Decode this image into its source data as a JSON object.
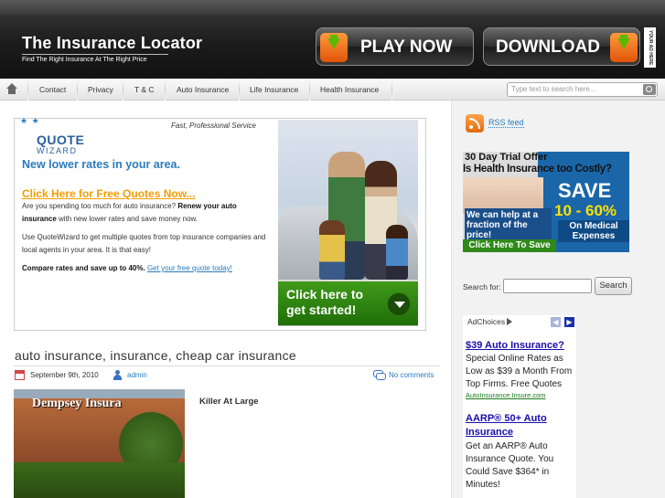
{
  "header": {
    "title": "The Insurance Locator",
    "tagline": "Find The Right Insurance At The Right Price",
    "play_label": "PLAY NOW",
    "download_label": "DOWNLOAD",
    "side_tab": "YOUR AD HERE"
  },
  "nav": {
    "items": [
      "Contact",
      "Privacy",
      "T & C",
      "Auto Insurance",
      "Life Insurance",
      "Health Insurance"
    ],
    "search_placeholder": "Type text to search here..."
  },
  "ad": {
    "logo_stars": "★ ★",
    "logo_line1": "QUOTE",
    "logo_line2": "WIZARD",
    "fast_service": "Fast, Professional Service",
    "headline": "New lower rates in your area.",
    "cta": "Click Here for Free Quotes Now...",
    "para1_a": "Are you spending too much for auto insurance?",
    "para1_b": "Renew your auto insurance",
    "para1_c": "with new lower rates and save money now.",
    "para2": "Use QuoteWizard to get multiple quotes from top insurance companies and local agents in your area. It is that easy!",
    "para3_b": "Compare rates and save up to 40%.",
    "para3_link": "Get your free quote today!",
    "start_text": "Click here to get started!"
  },
  "post": {
    "title": "auto insurance, insurance, cheap car insurance",
    "date": "September 9th, 2010",
    "author": "admin",
    "comments": "No comments",
    "image_sign": "Dempsey Insura",
    "caption": "Killer At Large"
  },
  "sidebar": {
    "rss_label": "RSS feed",
    "trial": {
      "line1": "30 Day Trial Offer",
      "line2": "Is Health Insurance too Costly?",
      "help": "We can help at a fraction of the price!",
      "click": "Click Here To Save",
      "save": "SAVE",
      "pct": "10 - 60%",
      "medical": "On Medical Expenses"
    },
    "search_label": "Search for:",
    "search_button": "Search",
    "adchoices": "AdChoices",
    "ads": [
      {
        "heading": "$39 Auto Insurance?",
        "text": "Special Online Rates as Low as $39 a Month From Top Firms. Free Quotes",
        "url": "AutoInsurance.Insure.com"
      },
      {
        "heading": "AARP® 50+ Auto Insurance",
        "text": "Get an AARP® Auto Insurance Quote. You Could Save $364* in Minutes!"
      }
    ]
  },
  "colors": {
    "link_blue": "#2a7bbd",
    "cta_orange": "#f39c00",
    "start_green": "#2f8a1a",
    "header_dark": "#1c1c1c"
  }
}
